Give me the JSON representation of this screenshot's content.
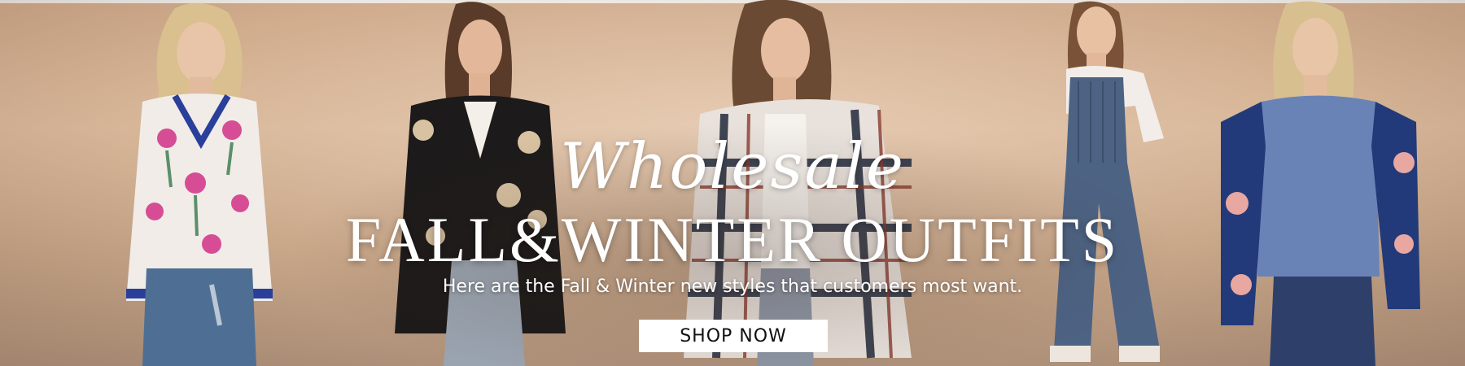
{
  "banner": {
    "script_title": "Wholesale",
    "main_title": "FALL&WINTER OUTFITS",
    "subtitle": "Here are the Fall & Winter new styles that customers most want.",
    "button_label": "SHOP NOW"
  },
  "colors": {
    "background": "#d4b194",
    "text": "#ffffff",
    "button_bg": "#ffffff",
    "button_text": "#111111"
  }
}
